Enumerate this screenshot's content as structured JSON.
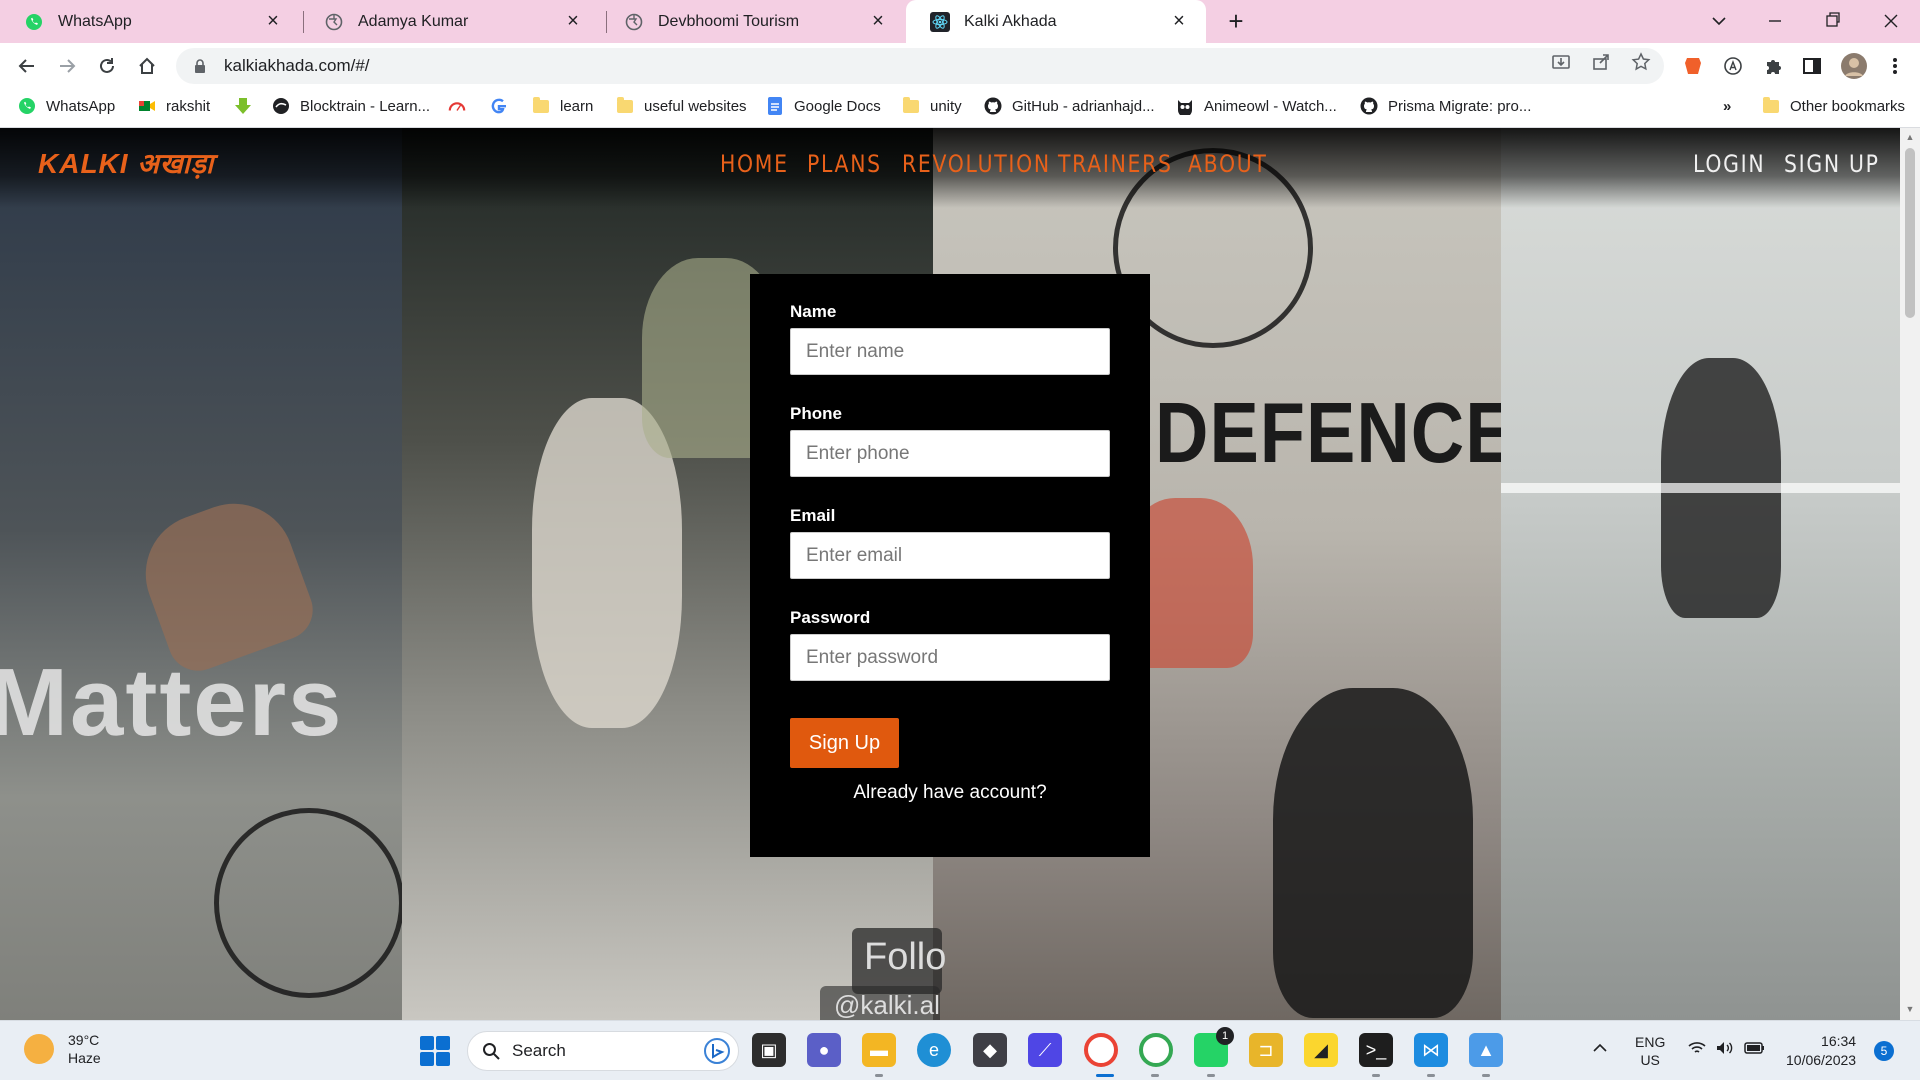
{
  "browser": {
    "tabs": [
      {
        "title": "WhatsApp",
        "favicon": "whatsapp-icon",
        "active": false
      },
      {
        "title": "Adamya Kumar",
        "favicon": "globe-icon",
        "active": false
      },
      {
        "title": "Devbhoomi Tourism",
        "favicon": "globe-icon",
        "active": false
      },
      {
        "title": "Kalki Akhada",
        "favicon": "react-icon",
        "active": true
      }
    ],
    "url": "kalkiakhada.com/#/",
    "bookmarks": [
      {
        "label": "WhatsApp",
        "icon": "whatsapp-icon"
      },
      {
        "label": "rakshit",
        "icon": "meet-icon"
      },
      {
        "label": "",
        "icon": "download-arrow-icon"
      },
      {
        "label": "Blocktrain - Learn...",
        "icon": "blocktrain-icon"
      },
      {
        "label": "",
        "icon": "speedometer-icon"
      },
      {
        "label": "",
        "icon": "google-icon"
      },
      {
        "label": "learn",
        "icon": "folder-icon"
      },
      {
        "label": "useful websites",
        "icon": "folder-icon"
      },
      {
        "label": "Google Docs",
        "icon": "docs-icon"
      },
      {
        "label": "unity",
        "icon": "folder-icon"
      },
      {
        "label": "GitHub - adrianhajd...",
        "icon": "github-icon"
      },
      {
        "label": "Animeowl - Watch...",
        "icon": "animeowl-icon"
      },
      {
        "label": "Prisma Migrate: pro...",
        "icon": "github-icon"
      }
    ],
    "bookmarks_overflow": "»",
    "other_bookmarks": "Other bookmarks"
  },
  "site": {
    "logo_text": "KALKI अखाड़ा",
    "nav": [
      "HOME",
      "PLANS",
      "REVOLUTION",
      "TRAINERS",
      "ABOUT"
    ],
    "auth_nav": [
      "LOGIN",
      "SIGN UP"
    ],
    "accent_color": "#e8611a",
    "background_texts": {
      "matters": "Matters",
      "defence": "DEFENCE",
      "follow": "Follo",
      "handle": "@kalki.al"
    },
    "form": {
      "name_label": "Name",
      "name_placeholder": "Enter name",
      "phone_label": "Phone",
      "phone_placeholder": "Enter phone",
      "email_label": "Email",
      "email_placeholder": "Enter email",
      "password_label": "Password",
      "password_placeholder": "Enter password",
      "submit_label": "Sign Up",
      "submit_color": "#e0590e",
      "already_account": "Already have account?"
    }
  },
  "taskbar": {
    "weather_temp": "39°C",
    "weather_desc": "Haze",
    "search_label": "Search",
    "language": "ENG",
    "region": "US",
    "time": "16:34",
    "date": "10/06/2023",
    "notification_count": "5",
    "whatsapp_badge": "1"
  }
}
